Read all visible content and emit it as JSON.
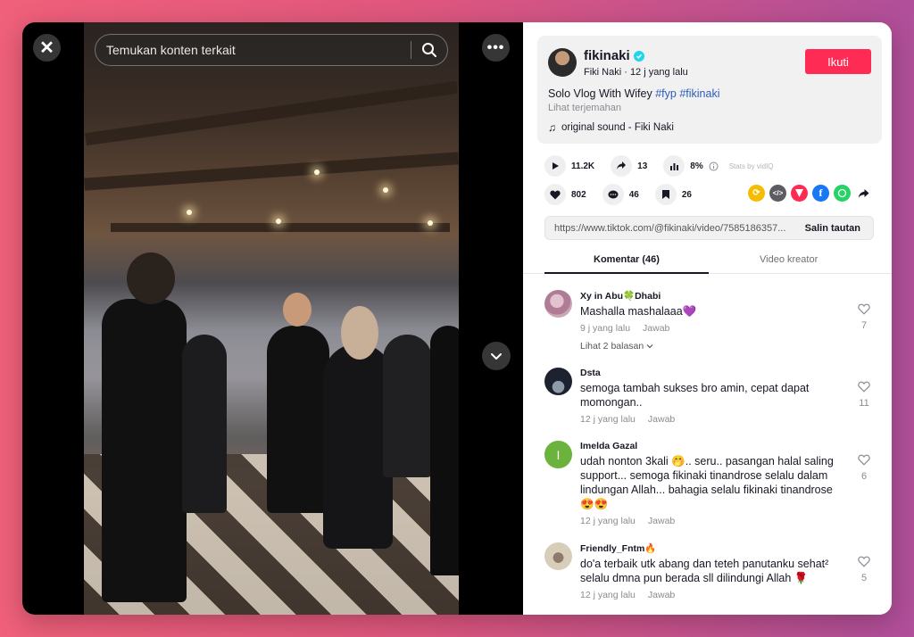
{
  "video": {
    "search_placeholder": "Temukan konten terkait"
  },
  "author": {
    "username": "fikinaki",
    "display_line": "Fiki Naki · 12 j yang lalu",
    "follow_label": "Ikuti"
  },
  "post": {
    "caption": "Solo Vlog With Wifey ",
    "hashtags": [
      "#fyp",
      "#fikinaki"
    ],
    "translate_label": "Lihat terjemahan",
    "sound": "original sound - Fiki Naki"
  },
  "stats": {
    "plays": "11.2K",
    "shares": "13",
    "engagement": "8%",
    "stats_by": "Stats by vidIQ",
    "likes": "802",
    "comments": "46",
    "saves": "26"
  },
  "share_icons": [
    "repost-icon",
    "embed-icon",
    "send-icon",
    "facebook-icon",
    "whatsapp-icon",
    "share-arrow-icon"
  ],
  "link": {
    "url": "https://www.tiktok.com/@fikinaki/video/7585186357...",
    "copy_label": "Salin tautan"
  },
  "tabs": {
    "comments": "Komentar (46)",
    "creator_videos": "Video kreator"
  },
  "comments": [
    {
      "user": "Xy in Abu🍀Dhabi",
      "text": "Mashalla mashalaaa💜",
      "time": "9 j yang lalu",
      "reply": "Jawab",
      "likes": "7",
      "more": "Lihat 2 balasan",
      "avatar_color": "#c9a6b8"
    },
    {
      "user": "Dsta",
      "text": "semoga tambah sukses bro amin, cepat dapat momongan..",
      "time": "12 j yang lalu",
      "reply": "Jawab",
      "likes": "11",
      "avatar_color": "#2a3140"
    },
    {
      "user": "Imelda Gazal",
      "text": "udah nonton 3kali 🤭.. seru.. pasangan halal saling support... semoga fikinaki tinandrose selalu dalam lindungan Allah... bahagia selalu fikinaki tinandrose 😍😍",
      "time": "12 j yang lalu",
      "reply": "Jawab",
      "likes": "6",
      "avatar_letter": "I",
      "avatar_color": "#6bb33d"
    },
    {
      "user": "Friendly_Fntm🔥",
      "text": "do'a terbaik utk abang dan teteh panutanku sehat² selalu dmna pun berada sll dilindungi Allah 🌹",
      "time": "12 j yang lalu",
      "reply": "Jawab",
      "likes": "5",
      "avatar_color": "#d8cdb8"
    }
  ],
  "colors": {
    "follow": "#fe2c55",
    "hashtag": "#2b5db9",
    "verified": "#20d5ec"
  }
}
